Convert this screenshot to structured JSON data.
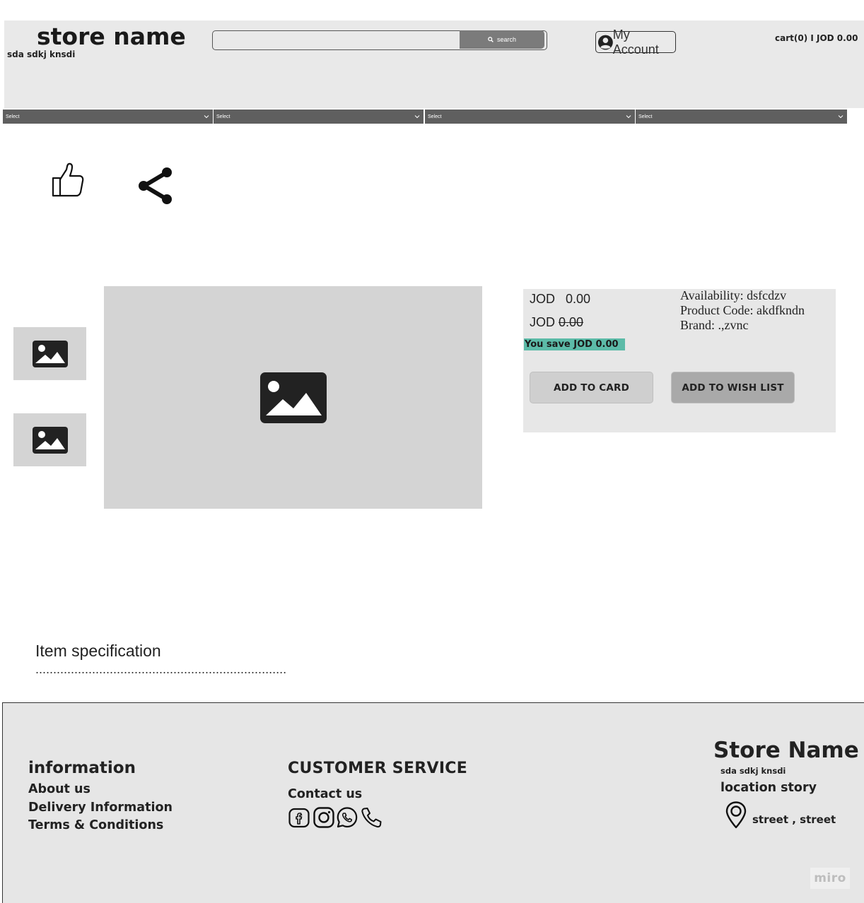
{
  "header": {
    "store_name": "store name",
    "tagline": "sda sdkj knsdi",
    "search_placeholder": "",
    "search_label": "search",
    "account_label": "My Account",
    "cart_text": "cart(0) I  JOD 0.00"
  },
  "nav_selects": [
    {
      "value": "Select"
    },
    {
      "value": "Select"
    },
    {
      "value": "Select"
    },
    {
      "value": "Select"
    }
  ],
  "icons": {
    "like": "thumbs-up-icon",
    "share": "share-icon",
    "image": "image-placeholder-icon"
  },
  "product": {
    "currency": "JOD",
    "price": "0.00",
    "old_price": "0.00",
    "save_text": "You save JOD 0.00",
    "availability": "Availability: dsfcdzv",
    "product_code": "Product Code: akdfkndn",
    "brand": "Brand: .,zvnc",
    "add_to_card_label": "ADD TO CARD",
    "add_to_wishlist_label": "ADD TO WISH LIST"
  },
  "specification": {
    "title": "Item specification",
    "content": "......................................................................."
  },
  "footer": {
    "information_title": "information",
    "information_links": [
      "About us",
      "Delivery Information",
      "Terms & Conditions"
    ],
    "customer_service_title": "CUSTOMER SERVICE",
    "contact_label": "Contact us",
    "social_icons": [
      "facebook-icon",
      "instagram-icon",
      "whatsapp-icon",
      "phone-icon"
    ],
    "store_name": "Store Name",
    "tagline": "sda sdkj knsdi",
    "location_title": "location story",
    "address": "street , street",
    "watermark": "miro"
  },
  "colors": {
    "header_bg": "#e9e9e9",
    "select_bg": "#5f5f5f",
    "save_badge": "#5cbba8",
    "wishlist_btn": "#a9a9a9",
    "image_placeholder": "#d4d4d4"
  }
}
